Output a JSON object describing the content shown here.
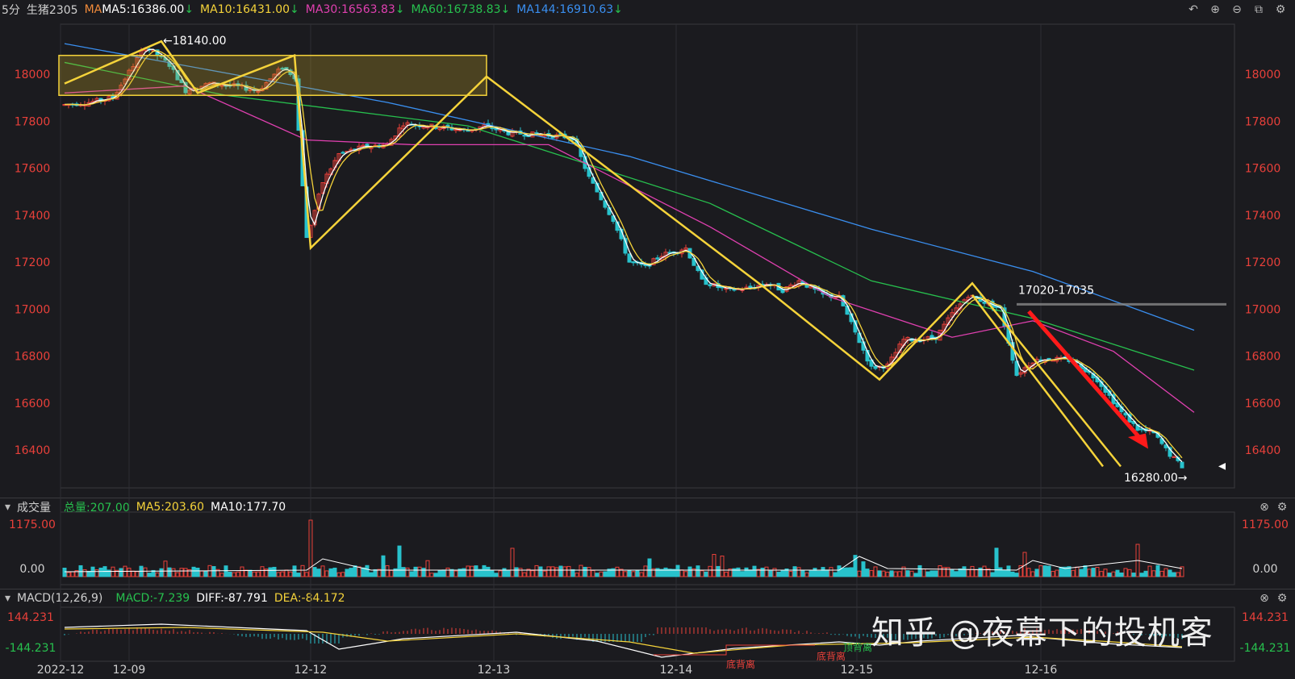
{
  "header": {
    "period": "5分",
    "symbol": "生猪2305",
    "ma_label": "MA",
    "ma5": "MA5:16386.00",
    "ma10": "MA10:16431.00",
    "ma30": "MA30:16563.83",
    "ma60": "MA60:16738.83",
    "ma144": "MA144:16910.63",
    "down_arrow": "↓"
  },
  "volume_header": {
    "title": "成交量",
    "total": "总量:207.00",
    "ma5": "MA5:203.60",
    "ma10": "MA10:177.70"
  },
  "macd_header": {
    "title": "MACD(12,26,9)",
    "macd": "MACD:-7.239",
    "diff": "DIFF:-87.791",
    "dea": "DEA:-84.172"
  },
  "annotations": {
    "high_label": "←18140.00",
    "low_label": "16280.00→",
    "zone_label": "17020-17035",
    "divergence_1": "底背离",
    "divergence_2": "底背离",
    "divergence_3": "顶背离"
  },
  "watermark": "知乎 @夜幕下的投机客",
  "colors": {
    "up": "#e8403a",
    "down": "#28c2cc",
    "ma5": "#ffffff",
    "ma10": "#f5d33a",
    "ma30": "#e040b0",
    "ma60": "#27c04e",
    "ma144": "#3a8ff0",
    "zigzag": "#f5d33a",
    "arrow": "#ff1a1a",
    "axis_left": "#e8403a",
    "axis_right": "#e8403a"
  },
  "icons": [
    "undo-icon",
    "zoom-in-icon",
    "zoom-out-icon",
    "window-icon",
    "settings-icon"
  ],
  "chart_data": {
    "type": "candlestick",
    "x_ticks": [
      "2022-12",
      "12-09",
      "12-12",
      "12-13",
      "12-14",
      "12-15",
      "12-16"
    ],
    "y_ticks": [
      16400,
      16600,
      16800,
      17000,
      17200,
      17400,
      17600,
      17800,
      18000
    ],
    "ylim": [
      16280,
      18140
    ],
    "price_path": [
      [
        0,
        17870
      ],
      [
        30,
        17880
      ],
      [
        60,
        17900
      ],
      [
        100,
        18120
      ],
      [
        130,
        18040
      ],
      [
        150,
        17930
      ],
      [
        180,
        17960
      ],
      [
        210,
        17950
      ],
      [
        240,
        17930
      ],
      [
        270,
        18030
      ],
      [
        285,
        17990
      ],
      [
        300,
        17300
      ],
      [
        320,
        17540
      ],
      [
        340,
        17660
      ],
      [
        370,
        17690
      ],
      [
        400,
        17700
      ],
      [
        420,
        17790
      ],
      [
        450,
        17780
      ],
      [
        500,
        17760
      ],
      [
        520,
        17780
      ],
      [
        550,
        17750
      ],
      [
        600,
        17740
      ],
      [
        630,
        17730
      ],
      [
        650,
        17560
      ],
      [
        680,
        17380
      ],
      [
        700,
        17200
      ],
      [
        720,
        17180
      ],
      [
        740,
        17230
      ],
      [
        770,
        17260
      ],
      [
        790,
        17120
      ],
      [
        820,
        17080
      ],
      [
        850,
        17090
      ],
      [
        870,
        17110
      ],
      [
        890,
        17080
      ],
      [
        910,
        17120
      ],
      [
        940,
        17060
      ],
      [
        960,
        17050
      ],
      [
        980,
        16900
      ],
      [
        1000,
        16750
      ],
      [
        1020,
        16760
      ],
      [
        1040,
        16870
      ],
      [
        1060,
        16870
      ],
      [
        1080,
        16880
      ],
      [
        1100,
        16980
      ],
      [
        1120,
        17060
      ],
      [
        1140,
        17030
      ],
      [
        1160,
        17000
      ],
      [
        1180,
        16720
      ],
      [
        1200,
        16780
      ],
      [
        1220,
        16790
      ],
      [
        1250,
        16780
      ],
      [
        1280,
        16700
      ],
      [
        1310,
        16560
      ],
      [
        1330,
        16490
      ],
      [
        1350,
        16470
      ],
      [
        1370,
        16380
      ],
      [
        1385,
        16330
      ]
    ],
    "ma144_path": [
      [
        0,
        18130
      ],
      [
        400,
        17880
      ],
      [
        700,
        17650
      ],
      [
        1000,
        17340
      ],
      [
        1200,
        17160
      ],
      [
        1400,
        16910
      ]
    ],
    "ma60_path": [
      [
        0,
        18050
      ],
      [
        200,
        17910
      ],
      [
        500,
        17780
      ],
      [
        800,
        17450
      ],
      [
        1000,
        17120
      ],
      [
        1200,
        16960
      ],
      [
        1400,
        16740
      ]
    ],
    "ma30_path": [
      [
        0,
        17920
      ],
      [
        150,
        17950
      ],
      [
        300,
        17720
      ],
      [
        430,
        17700
      ],
      [
        600,
        17700
      ],
      [
        800,
        17350
      ],
      [
        950,
        17050
      ],
      [
        1100,
        16880
      ],
      [
        1200,
        16950
      ],
      [
        1300,
        16820
      ],
      [
        1400,
        16560
      ]
    ],
    "volume": {
      "ylim": [
        0,
        1175
      ],
      "ticks": [
        "1175.00",
        "0.00"
      ]
    },
    "macd": {
      "ylim": [
        -144.231,
        144.231
      ],
      "ticks": [
        "144.231",
        "-144.231"
      ]
    }
  }
}
